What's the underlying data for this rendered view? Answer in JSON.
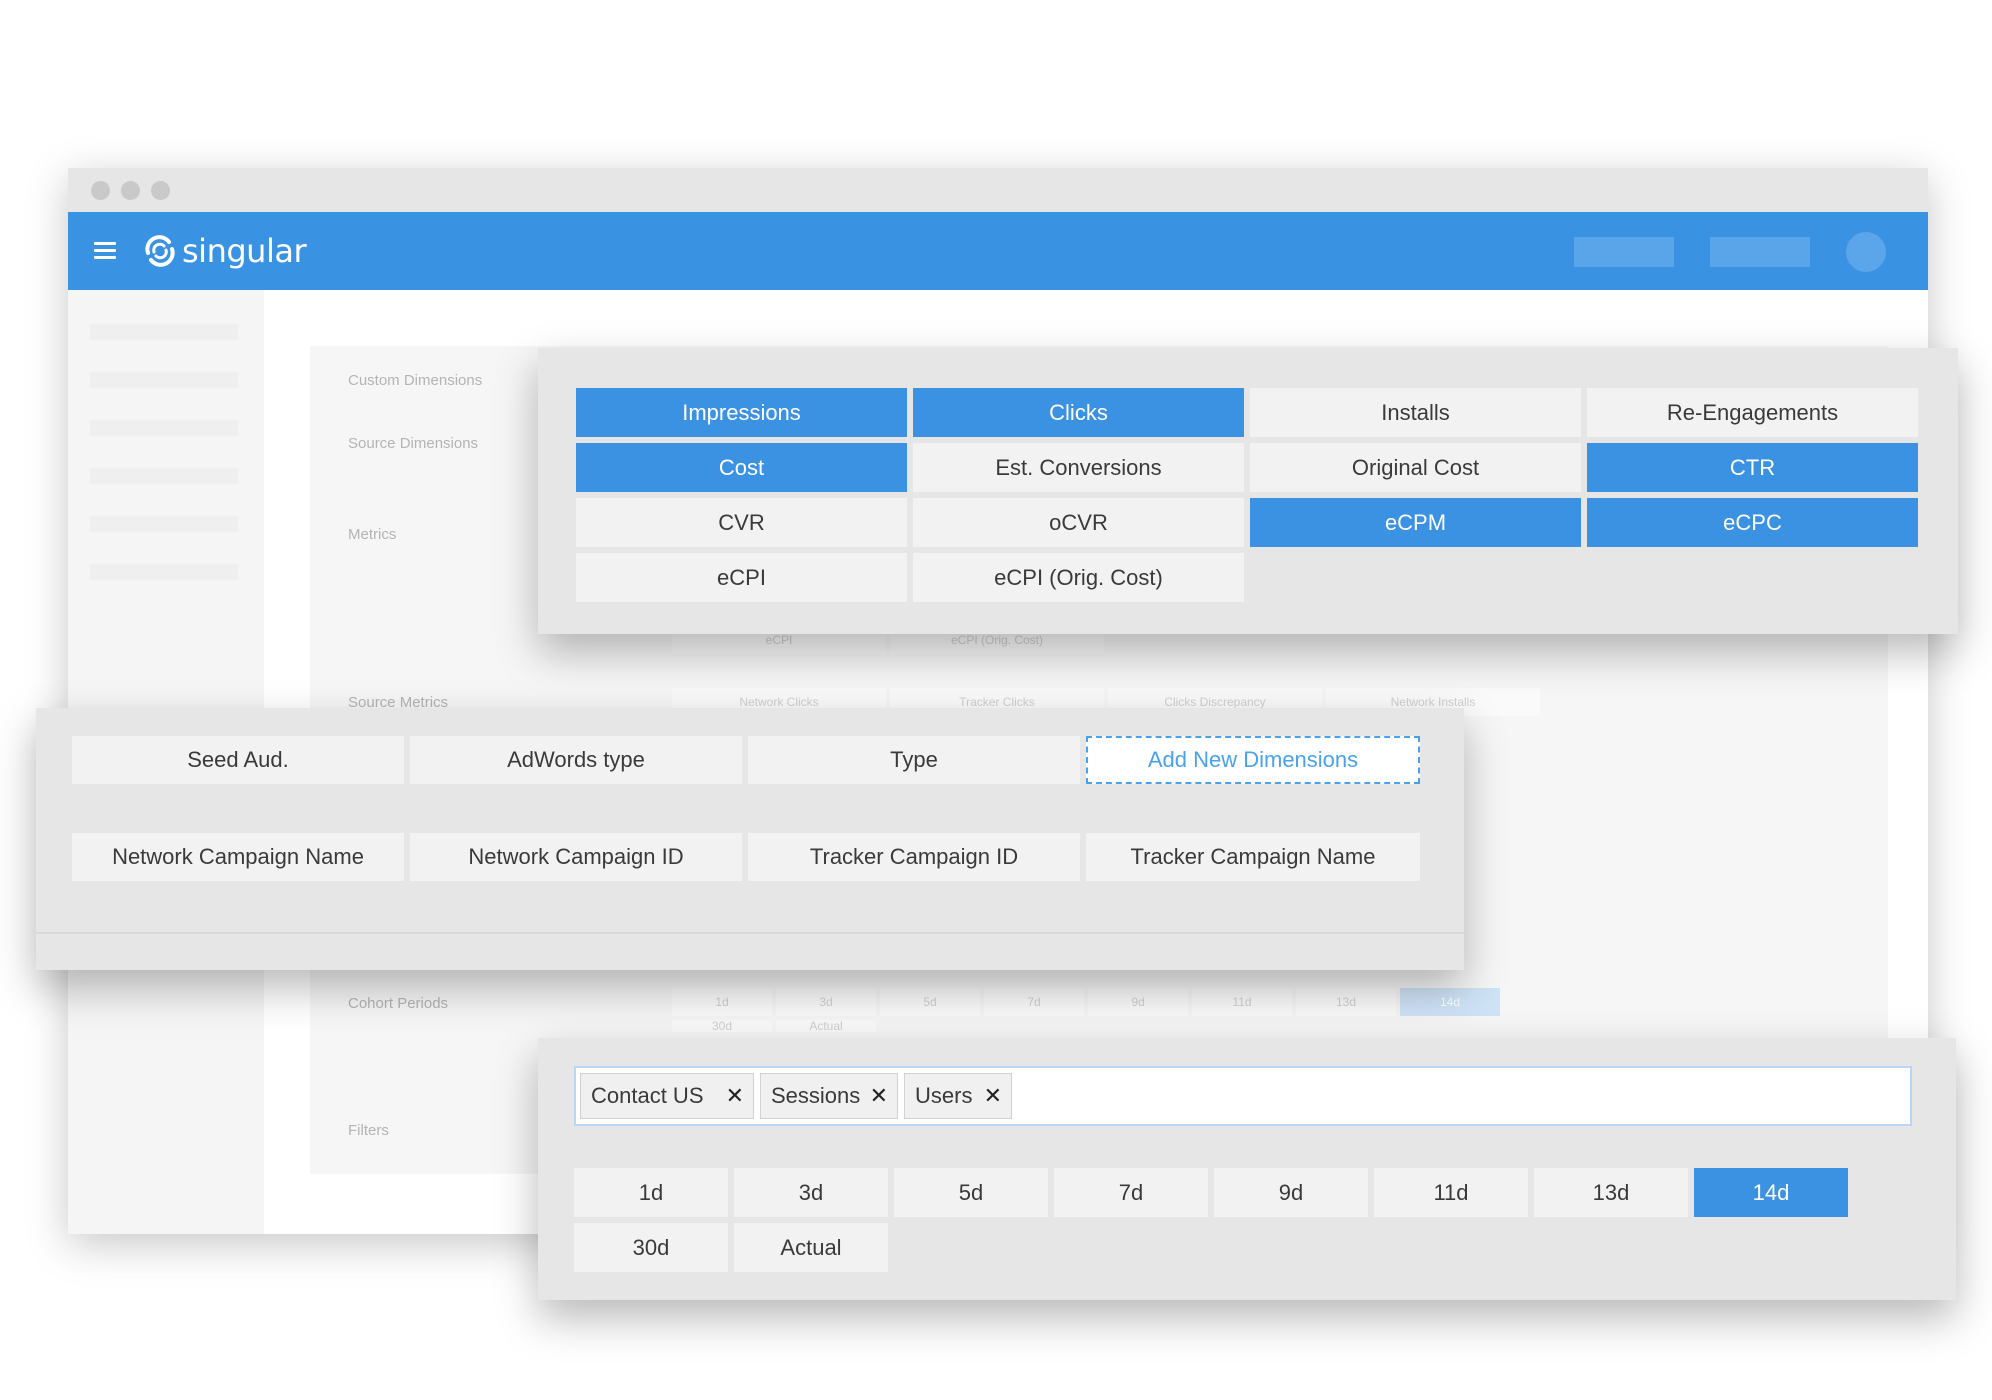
{
  "colors": {
    "brand_blue": "#3a92e2",
    "selected_blue": "#3b92e3",
    "link_blue": "#4aa1ee",
    "top_button": "#5aa5ea",
    "avatar": "#5ba6ea"
  },
  "app": {
    "brand_name": "singular",
    "menu_icon": "hamburger-menu-icon",
    "logo_icon": "singular-logo-icon"
  },
  "background": {
    "labels": {
      "custom_dimensions": "Custom Dimensions",
      "source_dimensions": "Source Dimensions",
      "metrics": "Metrics",
      "source_metrics": "Source Metrics",
      "cohort_periods": "Cohort Periods",
      "filters": "Filters"
    },
    "metrics_row": [
      "eCPI",
      "eCPI (Orig. Cost)"
    ],
    "source_metrics_row": [
      "Network Clicks",
      "Tracker Clicks",
      "Clicks Discrepancy",
      "Network Installs"
    ],
    "cohort_row": [
      "1d",
      "3d",
      "5d",
      "7d",
      "9d",
      "11d",
      "13d",
      "14d"
    ],
    "cohort_row2": [
      "30d",
      "Actual"
    ]
  },
  "metrics_card": {
    "items": [
      {
        "label": "Impressions",
        "selected": true
      },
      {
        "label": "Clicks",
        "selected": true
      },
      {
        "label": "Installs",
        "selected": false
      },
      {
        "label": "Re-Engagements",
        "selected": false
      },
      {
        "label": "Cost",
        "selected": true
      },
      {
        "label": "Est. Conversions",
        "selected": false
      },
      {
        "label": "Original Cost",
        "selected": false
      },
      {
        "label": "CTR",
        "selected": true
      },
      {
        "label": "CVR",
        "selected": false
      },
      {
        "label": "oCVR",
        "selected": false
      },
      {
        "label": "eCPM",
        "selected": true
      },
      {
        "label": "eCPC",
        "selected": true
      },
      {
        "label": "eCPI",
        "selected": false
      },
      {
        "label": "eCPI (Orig. Cost)",
        "selected": false
      }
    ]
  },
  "dimensions_card": {
    "custom": [
      "Seed Aud.",
      "AdWords type",
      "Type"
    ],
    "add_new_label": "Add New Dimensions",
    "source": [
      "Network Campaign Name",
      "Network Campaign ID",
      "Tracker Campaign ID",
      "Tracker Campaign Name"
    ]
  },
  "cohort_card": {
    "tags": [
      "Contact US",
      "Sessions",
      "Users"
    ],
    "remove_icon": "close-icon",
    "periods": [
      {
        "label": "1d",
        "selected": false
      },
      {
        "label": "3d",
        "selected": false
      },
      {
        "label": "5d",
        "selected": false
      },
      {
        "label": "7d",
        "selected": false
      },
      {
        "label": "9d",
        "selected": false
      },
      {
        "label": "11d",
        "selected": false
      },
      {
        "label": "13d",
        "selected": false
      },
      {
        "label": "14d",
        "selected": true
      },
      {
        "label": "30d",
        "selected": false
      },
      {
        "label": "Actual",
        "selected": false
      }
    ]
  }
}
